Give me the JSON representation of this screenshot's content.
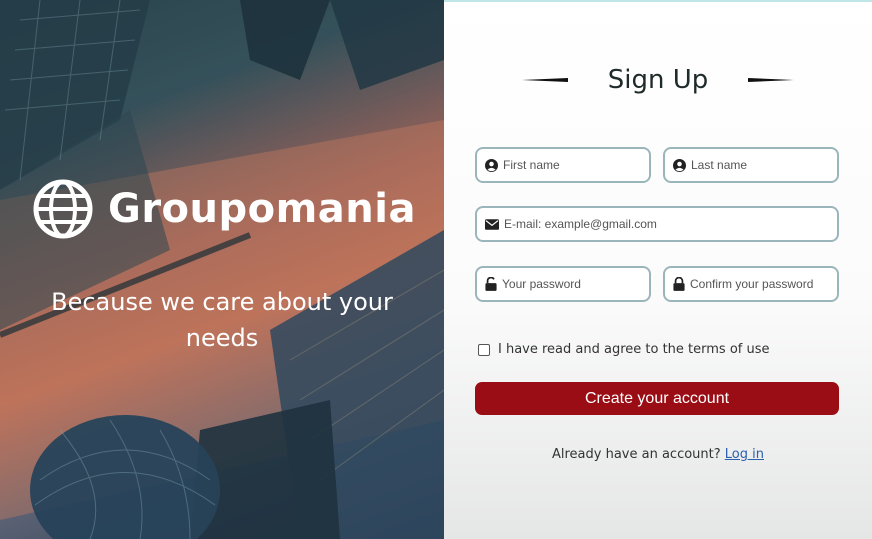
{
  "hero": {
    "brand_name": "Groupomania",
    "logo_icon": "globe-icon",
    "tagline": "Because we care about your needs"
  },
  "form": {
    "title": "Sign Up",
    "first_name": {
      "placeholder": "First name",
      "value": "",
      "icon": "user-circle-icon"
    },
    "last_name": {
      "placeholder": "Last name",
      "value": "",
      "icon": "user-circle-icon"
    },
    "email": {
      "placeholder": "E-mail: example@gmail.com",
      "value": "",
      "icon": "envelope-icon"
    },
    "password": {
      "placeholder": "Your password",
      "value": "",
      "icon": "unlock-icon"
    },
    "confirm_password": {
      "placeholder": "Confirm your password",
      "value": "",
      "icon": "lock-icon"
    },
    "terms": {
      "label": "I have read and agree to the terms of use",
      "checked": false
    },
    "submit_label": "Create your account",
    "login_prompt": "Already have an account?",
    "login_link": "Log in"
  },
  "colors": {
    "primary_button": "#9a0d15",
    "field_border": "#9bb6bb",
    "link": "#2b5fb0"
  }
}
